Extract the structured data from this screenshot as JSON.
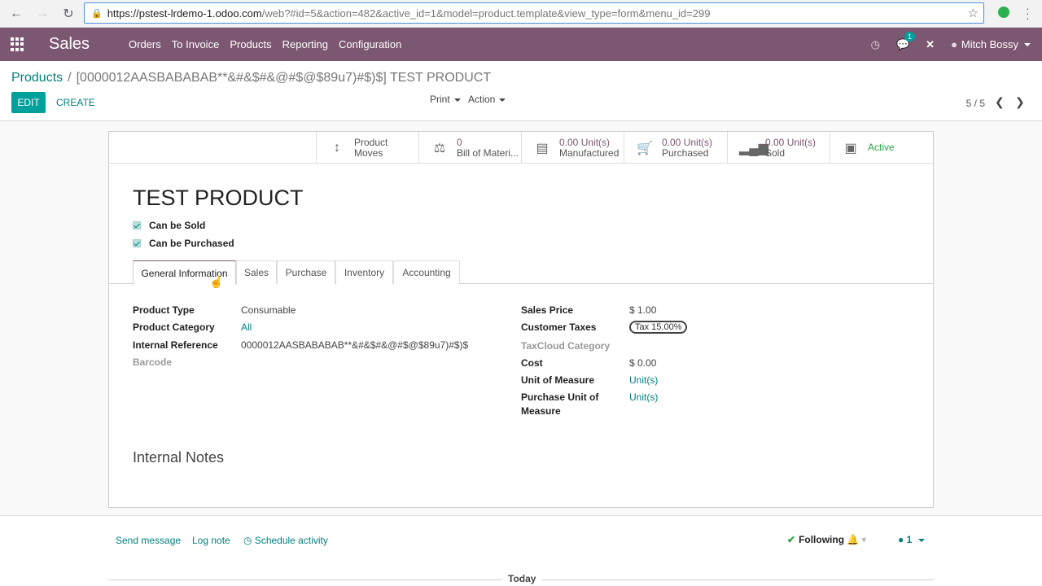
{
  "browser": {
    "url_main": "https://pstest-lrdemo-1.odoo.com",
    "url_rest": "/web?#id=5&action=482&active_id=1&model=product.template&view_type=form&menu_id=299"
  },
  "topnav": {
    "app_name": "Sales",
    "menu": [
      "Orders",
      "To Invoice",
      "Products",
      "Reporting",
      "Configuration"
    ],
    "messages_count": "1",
    "user_name": "Mitch Bossy"
  },
  "control_panel": {
    "breadcrumb_parent": "Products",
    "breadcrumb_current": "[0000012AASBABABAB**&#&$#&@#$@$89u7)#$)$] TEST PRODUCT",
    "edit_label": "EDIT",
    "create_label": "CREATE",
    "print_label": "Print",
    "action_label": "Action",
    "pager": "5 / 5"
  },
  "smart_buttons": [
    {
      "value": "Product",
      "label": "Moves",
      "icon": "arrows-vertical-icon"
    },
    {
      "value": "0",
      "label": "Bill of Materi...",
      "icon": "flask-icon"
    },
    {
      "value": "0.00 Unit(s)",
      "label": "Manufactured",
      "icon": "list-icon"
    },
    {
      "value": "0.00 Unit(s)",
      "label": "Purchased",
      "icon": "cart-icon"
    },
    {
      "value": "0.00 Unit(s)",
      "label": "Sold",
      "icon": "signal-icon"
    },
    {
      "value": "Active",
      "label": "",
      "icon": "archive-icon"
    }
  ],
  "product": {
    "name": "TEST PRODUCT",
    "can_be_sold": "Can be Sold",
    "can_be_purchased": "Can be Purchased"
  },
  "tabs": [
    "General Information",
    "Sales",
    "Purchase",
    "Inventory",
    "Accounting"
  ],
  "general_info": {
    "left": [
      {
        "label": "Product Type",
        "value": "Consumable"
      },
      {
        "label": "Product Category",
        "value": "All"
      },
      {
        "label": "Internal Reference",
        "value": "0000012AASBABABAB**&#&$#&@#$@$89u7)#$)$"
      },
      {
        "label": "Barcode",
        "value": ""
      }
    ],
    "right": [
      {
        "label": "Sales Price",
        "value": "$ 1.00"
      },
      {
        "label": "Customer Taxes",
        "value": "Tax 15.00%"
      },
      {
        "label": "TaxCloud Category",
        "value": ""
      },
      {
        "label": "Cost",
        "value": "$ 0.00"
      },
      {
        "label": "Unit of Measure",
        "value": "Unit(s)"
      },
      {
        "label": "Purchase Unit of",
        "label2": "Measure",
        "value": "Unit(s)"
      }
    ]
  },
  "internal_notes_title": "Internal Notes",
  "chatter": {
    "send_message": "Send message",
    "log_note": "Log note",
    "schedule_activity": "Schedule activity",
    "following": "Following",
    "followers_count": "1",
    "today": "Today"
  }
}
